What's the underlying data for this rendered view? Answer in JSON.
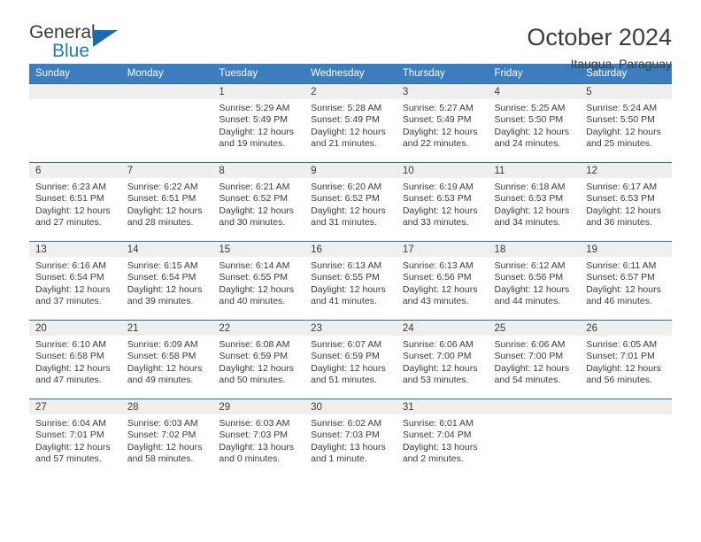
{
  "brand": {
    "name_part1": "General",
    "name_part2": "Blue",
    "triangle_icon": "triangle-icon",
    "primary_color": "#1a6cb0"
  },
  "header": {
    "title": "October 2024",
    "subtitle": "Itaugua, Paraguay"
  },
  "calendar": {
    "header_bg": "#3b7dbd",
    "weekdays": [
      "Sunday",
      "Monday",
      "Tuesday",
      "Wednesday",
      "Thursday",
      "Friday",
      "Saturday"
    ],
    "weeks": [
      [
        {
          "day": "",
          "lines": []
        },
        {
          "day": "",
          "lines": []
        },
        {
          "day": "1",
          "lines": [
            "Sunrise: 5:29 AM",
            "Sunset: 5:49 PM",
            "Daylight: 12 hours",
            "and 19 minutes."
          ]
        },
        {
          "day": "2",
          "lines": [
            "Sunrise: 5:28 AM",
            "Sunset: 5:49 PM",
            "Daylight: 12 hours",
            "and 21 minutes."
          ]
        },
        {
          "day": "3",
          "lines": [
            "Sunrise: 5:27 AM",
            "Sunset: 5:49 PM",
            "Daylight: 12 hours",
            "and 22 minutes."
          ]
        },
        {
          "day": "4",
          "lines": [
            "Sunrise: 5:25 AM",
            "Sunset: 5:50 PM",
            "Daylight: 12 hours",
            "and 24 minutes."
          ]
        },
        {
          "day": "5",
          "lines": [
            "Sunrise: 5:24 AM",
            "Sunset: 5:50 PM",
            "Daylight: 12 hours",
            "and 25 minutes."
          ]
        }
      ],
      [
        {
          "day": "6",
          "lines": [
            "Sunrise: 6:23 AM",
            "Sunset: 6:51 PM",
            "Daylight: 12 hours",
            "and 27 minutes."
          ]
        },
        {
          "day": "7",
          "lines": [
            "Sunrise: 6:22 AM",
            "Sunset: 6:51 PM",
            "Daylight: 12 hours",
            "and 28 minutes."
          ]
        },
        {
          "day": "8",
          "lines": [
            "Sunrise: 6:21 AM",
            "Sunset: 6:52 PM",
            "Daylight: 12 hours",
            "and 30 minutes."
          ]
        },
        {
          "day": "9",
          "lines": [
            "Sunrise: 6:20 AM",
            "Sunset: 6:52 PM",
            "Daylight: 12 hours",
            "and 31 minutes."
          ]
        },
        {
          "day": "10",
          "lines": [
            "Sunrise: 6:19 AM",
            "Sunset: 6:53 PM",
            "Daylight: 12 hours",
            "and 33 minutes."
          ]
        },
        {
          "day": "11",
          "lines": [
            "Sunrise: 6:18 AM",
            "Sunset: 6:53 PM",
            "Daylight: 12 hours",
            "and 34 minutes."
          ]
        },
        {
          "day": "12",
          "lines": [
            "Sunrise: 6:17 AM",
            "Sunset: 6:53 PM",
            "Daylight: 12 hours",
            "and 36 minutes."
          ]
        }
      ],
      [
        {
          "day": "13",
          "lines": [
            "Sunrise: 6:16 AM",
            "Sunset: 6:54 PM",
            "Daylight: 12 hours",
            "and 37 minutes."
          ]
        },
        {
          "day": "14",
          "lines": [
            "Sunrise: 6:15 AM",
            "Sunset: 6:54 PM",
            "Daylight: 12 hours",
            "and 39 minutes."
          ]
        },
        {
          "day": "15",
          "lines": [
            "Sunrise: 6:14 AM",
            "Sunset: 6:55 PM",
            "Daylight: 12 hours",
            "and 40 minutes."
          ]
        },
        {
          "day": "16",
          "lines": [
            "Sunrise: 6:13 AM",
            "Sunset: 6:55 PM",
            "Daylight: 12 hours",
            "and 41 minutes."
          ]
        },
        {
          "day": "17",
          "lines": [
            "Sunrise: 6:13 AM",
            "Sunset: 6:56 PM",
            "Daylight: 12 hours",
            "and 43 minutes."
          ]
        },
        {
          "day": "18",
          "lines": [
            "Sunrise: 6:12 AM",
            "Sunset: 6:56 PM",
            "Daylight: 12 hours",
            "and 44 minutes."
          ]
        },
        {
          "day": "19",
          "lines": [
            "Sunrise: 6:11 AM",
            "Sunset: 6:57 PM",
            "Daylight: 12 hours",
            "and 46 minutes."
          ]
        }
      ],
      [
        {
          "day": "20",
          "lines": [
            "Sunrise: 6:10 AM",
            "Sunset: 6:58 PM",
            "Daylight: 12 hours",
            "and 47 minutes."
          ]
        },
        {
          "day": "21",
          "lines": [
            "Sunrise: 6:09 AM",
            "Sunset: 6:58 PM",
            "Daylight: 12 hours",
            "and 49 minutes."
          ]
        },
        {
          "day": "22",
          "lines": [
            "Sunrise: 6:08 AM",
            "Sunset: 6:59 PM",
            "Daylight: 12 hours",
            "and 50 minutes."
          ]
        },
        {
          "day": "23",
          "lines": [
            "Sunrise: 6:07 AM",
            "Sunset: 6:59 PM",
            "Daylight: 12 hours",
            "and 51 minutes."
          ]
        },
        {
          "day": "24",
          "lines": [
            "Sunrise: 6:06 AM",
            "Sunset: 7:00 PM",
            "Daylight: 12 hours",
            "and 53 minutes."
          ]
        },
        {
          "day": "25",
          "lines": [
            "Sunrise: 6:06 AM",
            "Sunset: 7:00 PM",
            "Daylight: 12 hours",
            "and 54 minutes."
          ]
        },
        {
          "day": "26",
          "lines": [
            "Sunrise: 6:05 AM",
            "Sunset: 7:01 PM",
            "Daylight: 12 hours",
            "and 56 minutes."
          ]
        }
      ],
      [
        {
          "day": "27",
          "lines": [
            "Sunrise: 6:04 AM",
            "Sunset: 7:01 PM",
            "Daylight: 12 hours",
            "and 57 minutes."
          ]
        },
        {
          "day": "28",
          "lines": [
            "Sunrise: 6:03 AM",
            "Sunset: 7:02 PM",
            "Daylight: 12 hours",
            "and 58 minutes."
          ]
        },
        {
          "day": "29",
          "lines": [
            "Sunrise: 6:03 AM",
            "Sunset: 7:03 PM",
            "Daylight: 13 hours",
            "and 0 minutes."
          ]
        },
        {
          "day": "30",
          "lines": [
            "Sunrise: 6:02 AM",
            "Sunset: 7:03 PM",
            "Daylight: 13 hours",
            "and 1 minute."
          ]
        },
        {
          "day": "31",
          "lines": [
            "Sunrise: 6:01 AM",
            "Sunset: 7:04 PM",
            "Daylight: 13 hours",
            "and 2 minutes."
          ]
        },
        {
          "day": "",
          "lines": []
        },
        {
          "day": "",
          "lines": []
        }
      ]
    ]
  }
}
